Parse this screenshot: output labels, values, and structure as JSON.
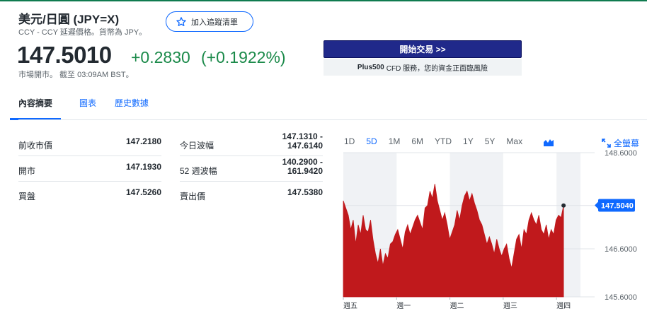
{
  "header": {
    "title": "美元/日圓 (JPY=X)",
    "subtitle": "CCY - CCY 延遲價格。貨幣為 JPY。",
    "watch_label": "加入追蹤清單"
  },
  "quote": {
    "price": "147.5010",
    "change": "+0.2830",
    "change_pct": "(+0.1922%)",
    "status": "市場開市。 截至 03:09AM BST。"
  },
  "promo": {
    "button_label": "開始交易 >>",
    "note_brand": "Plus500",
    "note_text": "CFD 服務，您的資金正面臨風險"
  },
  "tabs": [
    {
      "label": "內容摘要",
      "active": true
    },
    {
      "label": "圖表",
      "active": false
    },
    {
      "label": "歷史數據",
      "active": false
    }
  ],
  "stats": {
    "left": [
      {
        "label": "前收市價",
        "value": "147.2180"
      },
      {
        "label": "開市",
        "value": "147.1930"
      },
      {
        "label": "買盤",
        "value": "147.5260"
      }
    ],
    "right": [
      {
        "label": "今日波幅",
        "value_line1": "147.1310 -",
        "value_line2": "147.6140"
      },
      {
        "label": "52 週波幅",
        "value_line1": "140.2900 -",
        "value_line2": "161.9420"
      },
      {
        "label": "賣出價",
        "value_line1": "147.5380",
        "value_line2": ""
      }
    ]
  },
  "chart_controls": {
    "ranges": [
      "1D",
      "5D",
      "1M",
      "6M",
      "YTD",
      "1Y",
      "5Y",
      "Max"
    ],
    "active_range": "5D",
    "chart_type_icon": "mountain-chart-icon",
    "fullscreen_label": "全螢幕"
  },
  "chart_data": {
    "type": "area",
    "color": "#c0191c",
    "x_labels": [
      "週五",
      "週一",
      "週二",
      "週三",
      "週四"
    ],
    "y_ticks": [
      "148.6000",
      "146.6000",
      "145.6000"
    ],
    "current_label": "147.5040",
    "ylim": [
      145.6,
      148.6
    ],
    "y": [
      147.6,
      147.45,
      147.3,
      147.0,
      147.2,
      146.7,
      147.1,
      146.9,
      147.3,
      147.0,
      146.95,
      147.2,
      146.8,
      146.5,
      146.3,
      146.6,
      146.25,
      146.5,
      146.4,
      146.7,
      146.75,
      146.9,
      147.0,
      146.8,
      146.6,
      146.95,
      147.1,
      146.9,
      147.05,
      147.2,
      147.3,
      147.15,
      147.0,
      147.45,
      147.5,
      147.8,
      147.65,
      147.95,
      147.6,
      147.4,
      147.2,
      147.35,
      147.1,
      146.8,
      146.95,
      147.1,
      147.4,
      147.2,
      147.5,
      147.7,
      147.8,
      147.6,
      147.75,
      147.55,
      147.4,
      147.2,
      147.1,
      146.9,
      146.7,
      146.85,
      146.7,
      146.5,
      146.8,
      146.6,
      146.45,
      146.6,
      146.7,
      146.4,
      146.2,
      146.5,
      146.8,
      146.9,
      146.6,
      147.0,
      146.9,
      147.2,
      147.35,
      147.2,
      147.1,
      147.3,
      147.0,
      146.9,
      147.1,
      146.8,
      147.0,
      146.9,
      147.2,
      147.3,
      147.25,
      147.5
    ]
  }
}
